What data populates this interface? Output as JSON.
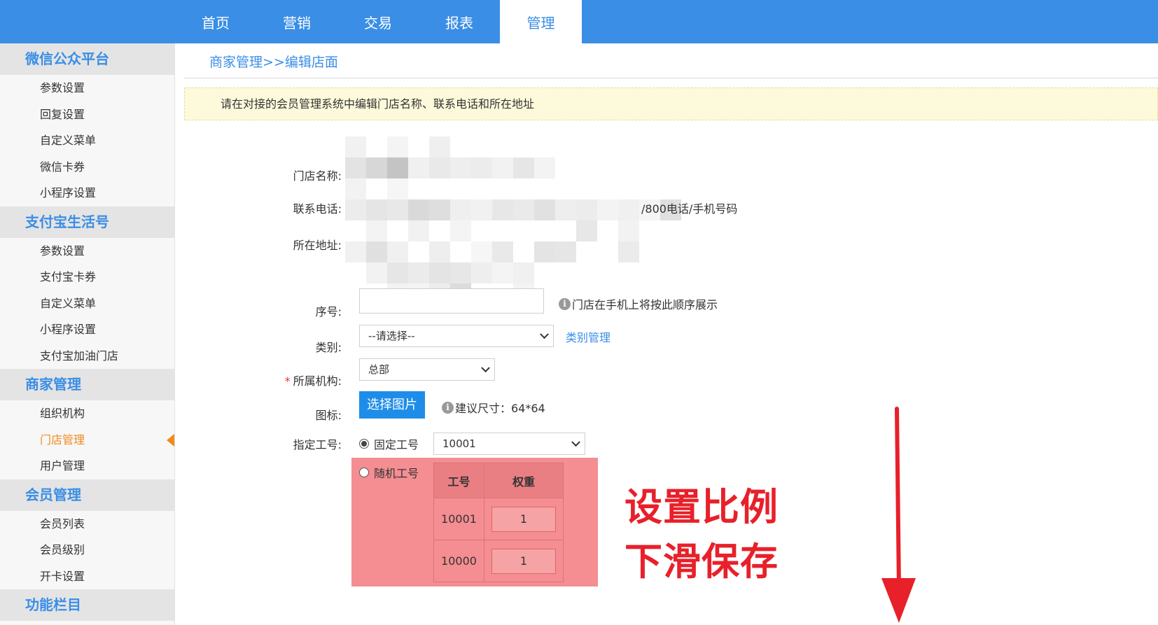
{
  "topnav": {
    "tabs": [
      {
        "label": "首页"
      },
      {
        "label": "营销"
      },
      {
        "label": "交易"
      },
      {
        "label": "报表"
      },
      {
        "label": "管理"
      }
    ],
    "active_tab": "管理"
  },
  "sidebar": {
    "groups": [
      {
        "title": "微信公众平台",
        "items": [
          "参数设置",
          "回复设置",
          "自定义菜单",
          "微信卡券",
          "小程序设置"
        ]
      },
      {
        "title": "支付宝生活号",
        "items": [
          "参数设置",
          "支付宝卡券",
          "自定义菜单",
          "小程序设置",
          "支付宝加油门店"
        ]
      },
      {
        "title": "商家管理",
        "items": [
          "组织机构",
          "门店管理",
          "用户管理"
        ]
      },
      {
        "title": "会员管理",
        "items": [
          "会员列表",
          "会员级别",
          "开卡设置"
        ]
      },
      {
        "title": "功能栏目",
        "items": []
      }
    ],
    "active_item": "门店管理"
  },
  "breadcrumb": "商家管理>>编辑店面",
  "notice": "请在对接的会员管理系统中编辑门店名称、联系电话和所在地址",
  "form": {
    "store_name_label": "门店名称:",
    "phone_label": "联系电话:",
    "phone_suffix": "/800电话/手机号码",
    "address_label": "所在地址:",
    "seq_label": "序号:",
    "seq_value": "",
    "seq_hint": "门店在手机上将按此顺序展示",
    "category_label": "类别:",
    "category_value": "--请选择--",
    "category_link": "类别管理",
    "org_label": "所属机构:",
    "org_required_mark": "*",
    "org_value": "总部",
    "icon_label": "图标:",
    "icon_button": "选择图片",
    "icon_hint": "建议尺寸：64*64",
    "staff_label": "指定工号:",
    "fixed_radio": "固定工号",
    "fixed_value": "10001",
    "random_radio": "随机工号",
    "weight_table": {
      "headers": [
        "工号",
        "权重"
      ],
      "rows": [
        {
          "id": "10001",
          "weight": "1"
        },
        {
          "id": "10000",
          "weight": "1"
        }
      ]
    }
  },
  "annotation": {
    "line1": "设置比例",
    "line2": "下滑保存",
    "color": "#e8202a"
  },
  "colors": {
    "accent": "#3a8ee6",
    "active_sidebar": "#f08a1c",
    "highlight": "#f48e92"
  }
}
